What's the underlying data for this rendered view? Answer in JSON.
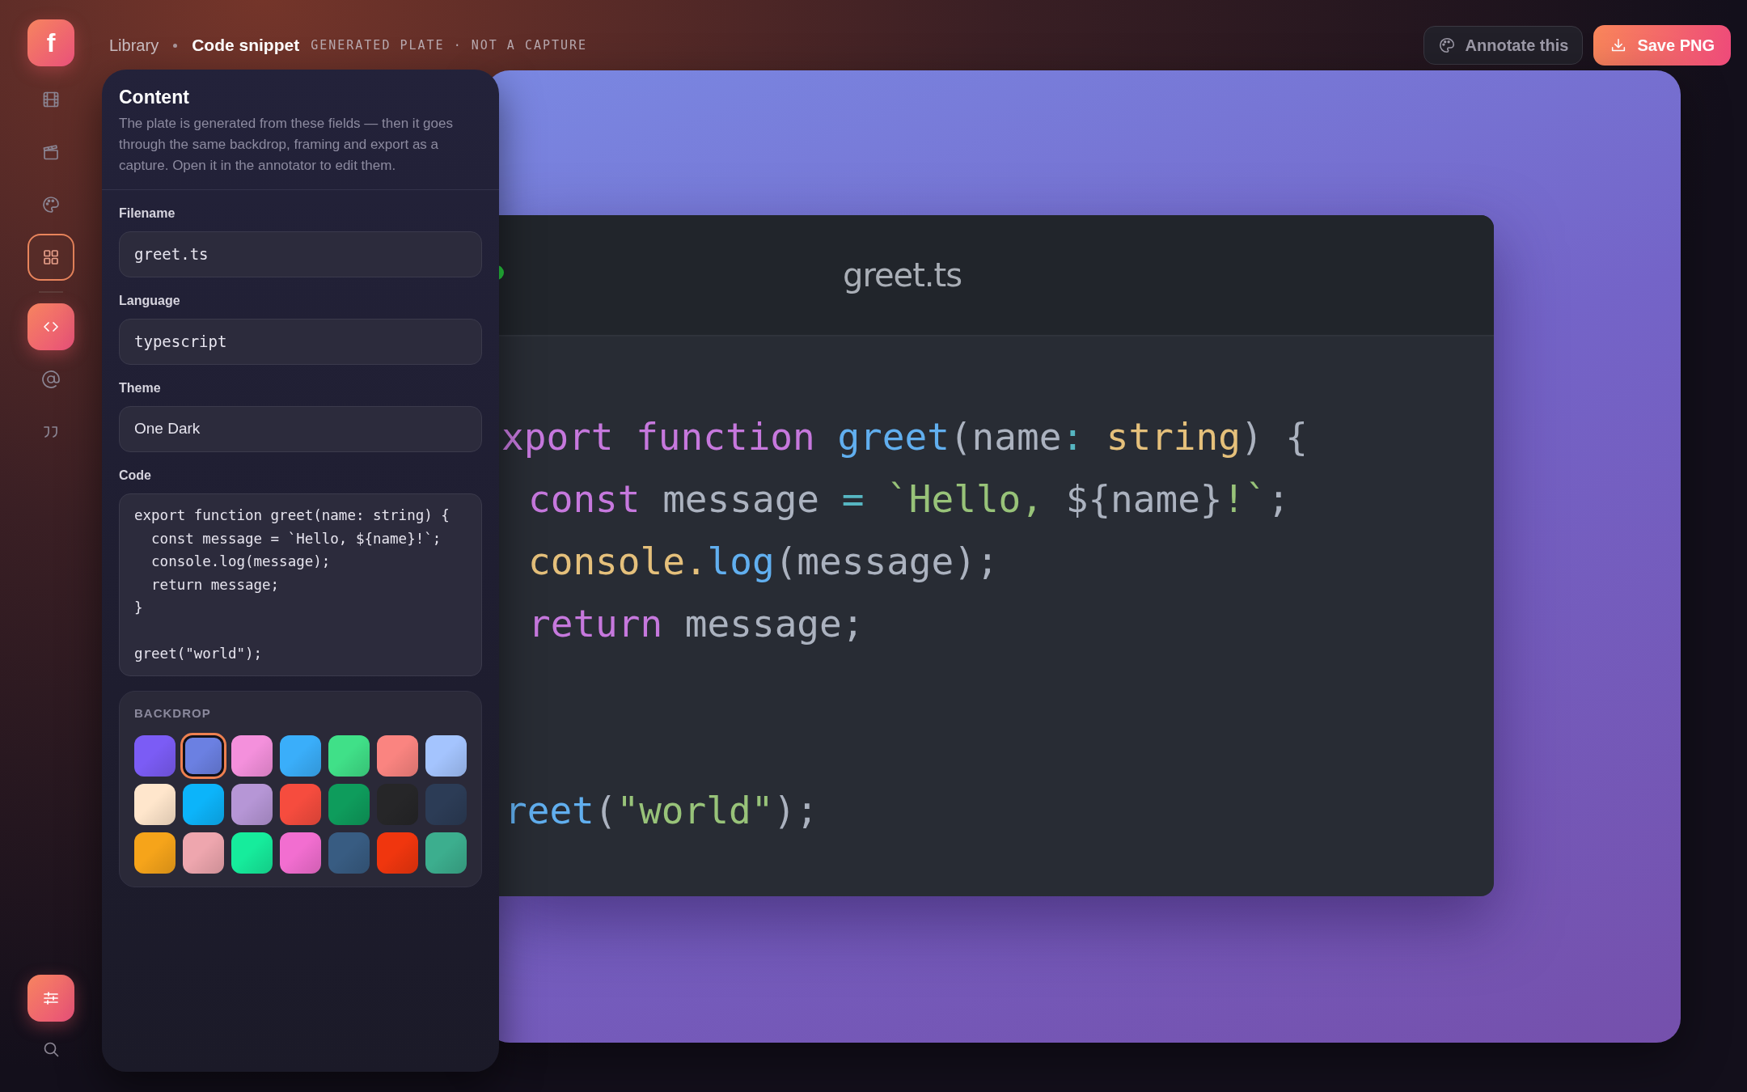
{
  "logo": {
    "letter": "f"
  },
  "sidebar": {
    "items": [
      {
        "selected": false,
        "active": false
      },
      {
        "selected": false,
        "active": false
      },
      {
        "selected": false,
        "active": false
      },
      {
        "selected": true,
        "active": false
      },
      {
        "selected": false,
        "active": true
      },
      {
        "selected": false,
        "active": false
      },
      {
        "selected": false,
        "active": false
      }
    ],
    "bottom": [
      {
        "active": true
      },
      {
        "active": false
      }
    ]
  },
  "header": {
    "breadcrumb": [
      "Library",
      "Code snippet"
    ],
    "tag": "GENERATED PLATE · NOT A CAPTURE",
    "buttons": [
      {
        "kind": "secondary",
        "label": "Annotate this"
      },
      {
        "kind": "primary",
        "label": "Save PNG"
      }
    ]
  },
  "panel": {
    "title": "Content",
    "description": "The plate is generated from these fields — then it goes through the same backdrop, framing and export as a capture. Open it in the annotator to edit them.",
    "fields": [
      {
        "label": "Filename",
        "value": "greet.ts",
        "kind": "mono"
      },
      {
        "label": "Language",
        "value": "typescript",
        "kind": "mono"
      },
      {
        "label": "Theme",
        "value": "One Dark",
        "kind": "text"
      },
      {
        "label": "Code",
        "value": "export function greet(name: string) {\n  const message = `Hello, ${name}!`;\n  console.log(message);\n  return message;\n}\n\ngreet(\"world\");",
        "kind": "code"
      }
    ]
  },
  "backdrop": {
    "title": "BACKDROP",
    "swatches": [
      {
        "color": "#7b5cf5",
        "selected": false
      },
      {
        "color": "#6b80e2",
        "selected": true
      },
      {
        "color": "#f490dc",
        "selected": false
      },
      {
        "color": "#3aaefa",
        "selected": false
      },
      {
        "color": "#40e088",
        "selected": false
      },
      {
        "color": "#fa8480",
        "selected": false
      },
      {
        "color": "#a4c4fe",
        "selected": false
      },
      {
        "color": "#ffe6cc",
        "selected": false
      },
      {
        "color": "#0cb4fa",
        "selected": false
      },
      {
        "color": "#b696d6",
        "selected": false
      },
      {
        "color": "#f64c3e",
        "selected": false
      },
      {
        "color": "#0e9c5c",
        "selected": false
      },
      {
        "color": "#262628",
        "selected": false
      },
      {
        "color": "#2c3c56",
        "selected": false
      },
      {
        "color": "#f6a41a",
        "selected": false
      },
      {
        "color": "#eea6ae",
        "selected": false
      },
      {
        "color": "#16ec9c",
        "selected": false
      },
      {
        "color": "#f26ed0",
        "selected": false
      },
      {
        "color": "#385c82",
        "selected": false
      },
      {
        "color": "#f0360e",
        "selected": false
      },
      {
        "color": "#3cae8e",
        "selected": false
      }
    ]
  },
  "plate": {
    "title": "greet.ts",
    "lines": [
      {
        "kind": "top",
        "tokens": [
          {
            "kind": "keyword",
            "text": "xport",
            "joined": true
          },
          {
            "kind": "keyword",
            "text": "function",
            "joined": false
          },
          {
            "kind": "function",
            "text": "greet",
            "joined": false
          },
          {
            "kind": "plain",
            "text": "(name",
            "joined": true
          },
          {
            "kind": "operator",
            "text": ":",
            "joined": true
          },
          {
            "kind": "type",
            "text": "string",
            "joined": false
          },
          {
            "kind": "plain",
            "text": ")",
            "joined": true
          },
          {
            "kind": "plain",
            "text": "{",
            "joined": false
          }
        ]
      },
      {
        "kind": "nested",
        "tokens": [
          {
            "kind": "keyword",
            "text": "const",
            "joined": true
          },
          {
            "kind": "plain",
            "text": "message",
            "joined": false
          },
          {
            "kind": "operator",
            "text": "=",
            "joined": false
          },
          {
            "kind": "string",
            "text": "`Hello,",
            "joined": false
          },
          {
            "kind": "plain",
            "text": "${name}",
            "joined": false
          },
          {
            "kind": "string",
            "text": "!`",
            "joined": true
          },
          {
            "kind": "plain",
            "text": ";",
            "joined": true
          }
        ]
      },
      {
        "kind": "nested",
        "tokens": [
          {
            "kind": "type",
            "text": "console.",
            "joined": true
          },
          {
            "kind": "function",
            "text": "log",
            "joined": true
          },
          {
            "kind": "plain",
            "text": "(message);",
            "joined": true
          }
        ]
      },
      {
        "kind": "nested",
        "tokens": [
          {
            "kind": "keyword",
            "text": "return",
            "joined": true
          },
          {
            "kind": "plain",
            "text": "message;",
            "joined": false
          }
        ]
      },
      {
        "kind": "after_gap",
        "tokens": [
          {
            "kind": "function",
            "text": "reet",
            "joined": true
          },
          {
            "kind": "plain",
            "text": "(",
            "joined": true
          },
          {
            "kind": "string",
            "text": "\"world\"",
            "joined": true
          },
          {
            "kind": "plain",
            "text": ");",
            "joined": true
          }
        ]
      }
    ]
  }
}
